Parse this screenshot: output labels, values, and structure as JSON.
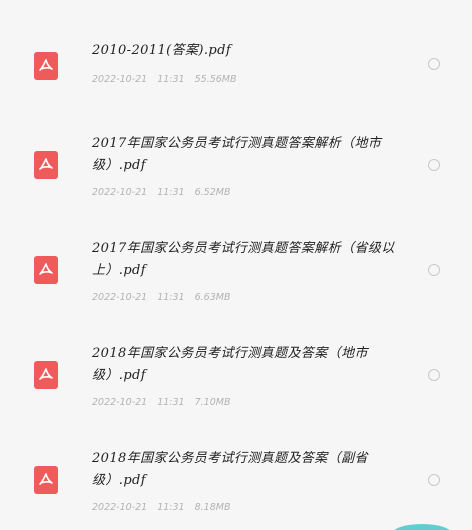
{
  "files": [
    {
      "name": "2010-2011(答案).pdf",
      "date": "2022-10-21",
      "time": "11:31",
      "size": "55.56MB",
      "icon": "pdf-icon"
    },
    {
      "name": "2017年国家公务员考试行测真题答案解析（地市级）.pdf",
      "date": "2022-10-21",
      "time": "11:31",
      "size": "6.52MB",
      "icon": "pdf-icon"
    },
    {
      "name": "2017年国家公务员考试行测真题答案解析（省级以上）.pdf",
      "date": "2022-10-21",
      "time": "11:31",
      "size": "6.63MB",
      "icon": "pdf-icon"
    },
    {
      "name": "2018年国家公务员考试行测真题及答案（地市级）.pdf",
      "date": "2022-10-21",
      "time": "11:31",
      "size": "7.10MB",
      "icon": "pdf-icon"
    },
    {
      "name": "2018年国家公务员考试行测真题及答案（副省级）.pdf",
      "date": "2022-10-21",
      "time": "11:31",
      "size": "8.18MB",
      "icon": "pdf-icon"
    }
  ],
  "colors": {
    "background": "#f6f6f6",
    "pdf_icon": "#ef5a5a",
    "meta_text": "#b3b3b3",
    "accent": "#45c7c9"
  }
}
